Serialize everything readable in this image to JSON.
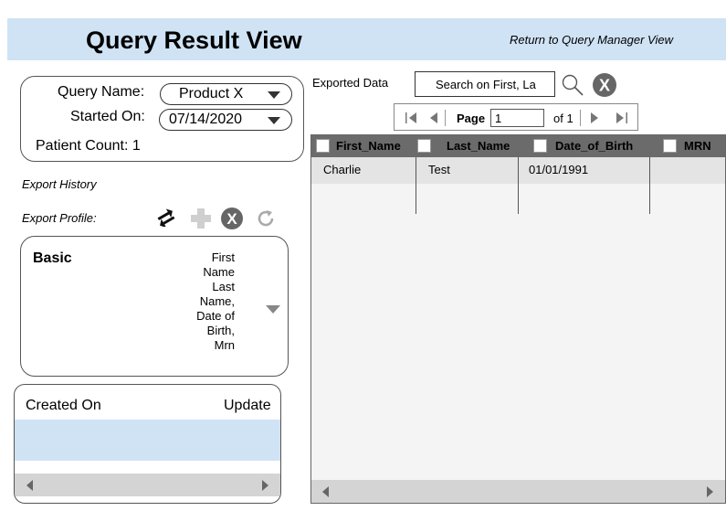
{
  "header": {
    "title": "Query Result View",
    "return_link": "Return to Query Manager View"
  },
  "query": {
    "name_label": "Query Name:",
    "name_value": "Product X",
    "started_label": "Started On:",
    "started_value": "07/14/2020",
    "patient_count": "Patient Count: 1"
  },
  "export": {
    "history_label": "Export History",
    "profile_label": "Export Profile:"
  },
  "icons": [
    "swap-arrows-icon",
    "plus-icon",
    "close-circle-icon",
    "refresh-icon",
    "magnifier-icon"
  ],
  "profile": {
    "name": "Basic",
    "fields": "First\nName\nLast\nName,\nDate of\nBirth,\nMrn"
  },
  "history": {
    "columns": [
      "Created On",
      "Update"
    ]
  },
  "data_panel": {
    "label": "Exported Data",
    "search_placeholder": "Search on First, La"
  },
  "pager": {
    "page_label": "Page",
    "page_value": "1",
    "of_label": "of 1"
  },
  "grid": {
    "columns": [
      "First_Name",
      "Last_Name",
      "Date_of_Birth",
      "MRN"
    ],
    "rows": [
      [
        "Charlie",
        "Test",
        "01/01/1991",
        ""
      ]
    ]
  },
  "colors": {
    "header_bg": "#cfe3f5",
    "grid_header": "#6b6b6b",
    "selected_row": "#cfe3f5"
  }
}
